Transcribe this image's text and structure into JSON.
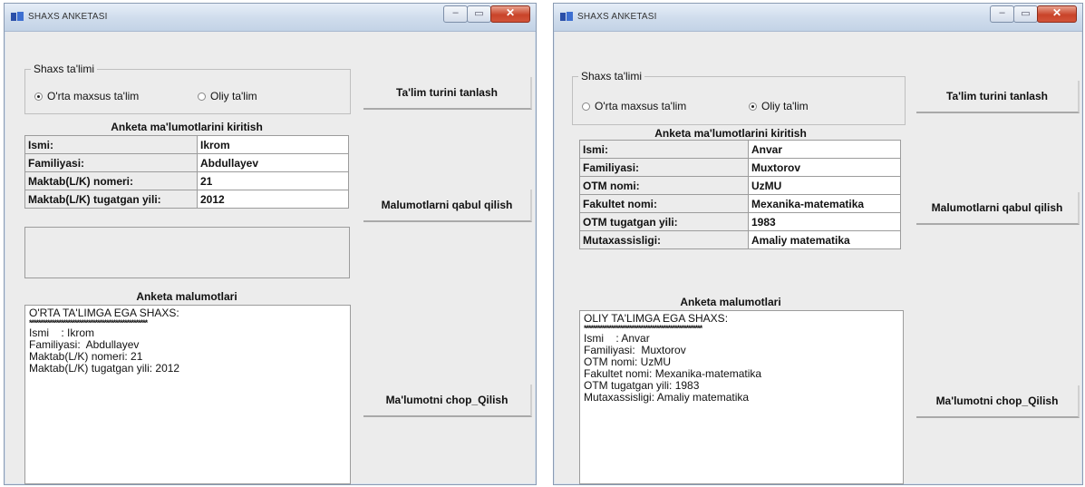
{
  "left": {
    "title": "SHAXS ANKETASI",
    "group_label": "Shaxs ta'limi",
    "radio1": "O'rta maxsus ta'lim",
    "radio2": "Oliy ta'lim",
    "radio_selected": 1,
    "btn_choose": "Ta'lim turini tanlash",
    "btn_accept": "Malumotlarni qabul qilish",
    "btn_print": "Ma'lumotni chop_Qilish",
    "form_heading": "Anketa ma'lumotlarini kiritish",
    "rows": [
      {
        "label": "Ismi:",
        "value": "Ikrom"
      },
      {
        "label": "Familiyasi:",
        "value": "Abdullayev"
      },
      {
        "label": "Maktab(L/K) nomeri:",
        "value": "21"
      },
      {
        "label": "Maktab(L/K) tugatgan yili:",
        "value": "2012"
      }
    ],
    "memo_heading": "Anketa malumotlari",
    "memo_lines": [
      "O'RTA TA'LIMGA EGA SHAXS:",
      "****************************************************",
      "",
      "Ismi    : Ikrom",
      "Familiyasi:  Abdullayev",
      "Maktab(L/K) nomeri: 21",
      "Maktab(L/K) tugatgan yili: 2012"
    ]
  },
  "right": {
    "title": "SHAXS ANKETASI",
    "group_label": "Shaxs ta'limi",
    "radio1": "O'rta maxsus ta'lim",
    "radio2": "Oliy ta'lim",
    "radio_selected": 2,
    "btn_choose": "Ta'lim turini tanlash",
    "btn_accept": "Malumotlarni qabul qilish",
    "btn_print": "Ma'lumotni chop_Qilish",
    "form_heading": "Anketa ma'lumotlarini kiritish",
    "rows": [
      {
        "label": "Ismi:",
        "value": "Anvar"
      },
      {
        "label": "Familiyasi:",
        "value": "Muxtorov"
      },
      {
        "label": "OTM nomi:",
        "value": "UzMU"
      },
      {
        "label": "Fakultet nomi:",
        "value": "Mexanika-matematika"
      },
      {
        "label": "OTM tugatgan yili:",
        "value": "1983"
      },
      {
        "label": "Mutaxassisligi:",
        "value": "Amaliy matematika"
      }
    ],
    "memo_heading": "Anketa malumotlari",
    "memo_lines": [
      "OLIY TA'LIMGA EGA SHAXS:",
      "****************************************************",
      "",
      "Ismi    : Anvar",
      "Familiyasi:  Muxtorov",
      "OTM nomi: UzMU",
      "Fakultet nomi: Mexanika-matematika",
      "OTM tugatgan yili: 1983",
      "Mutaxassisligi: Amaliy matematika"
    ]
  },
  "colors": {
    "window_bg": "#ececec",
    "titlebar": "#cfdcec",
    "close_button": "#c9442a"
  },
  "icons": {
    "app": "app-icon",
    "minimize": "minimize-icon",
    "maximize": "maximize-icon",
    "close": "close-icon"
  }
}
